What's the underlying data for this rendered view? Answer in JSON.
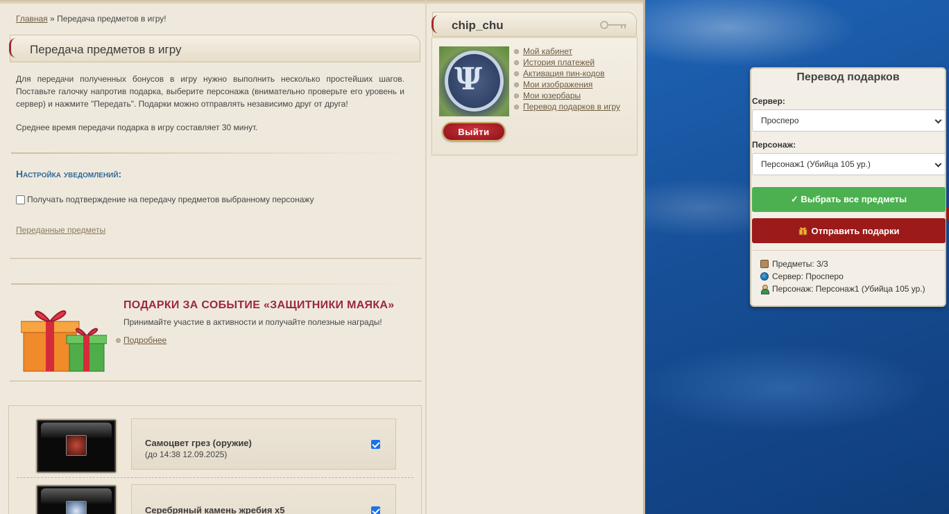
{
  "breadcrumb": {
    "home": "Главная",
    "separator": "»",
    "current": "Передача предметов в игру!"
  },
  "main": {
    "title": "Передача предметов в игру",
    "intro": "Для передачи полученных бонусов в игру нужно выполнить несколько простейших шагов. Поставьте галочку напротив подарка, выберите персонажа (внимательно проверьте его уровень и сервер) и нажмите \"Передать\". Подарки можно отправлять независимо друг от друга!",
    "avg_time": "Среднее время передачи подарка в игру составляет 30 минут.",
    "notifications": {
      "title": "Настройка уведомлений:",
      "checkbox_label": "Получать подтверждение на передачу предметов выбранному персонажу",
      "checked": false
    },
    "transferred_link": "Переданные предметы"
  },
  "event": {
    "title": "ПОДАРКИ ЗА СОБЫТИЕ «ЗАЩИТНИКИ МАЯКА»",
    "description": "Принимайте участие в активности и получайте полезные награды!",
    "more_link": "Подробнее"
  },
  "items": [
    {
      "name": "Самоцвет грез (оружие)",
      "until": "(до 14:38 12.09.2025)",
      "checked": true
    },
    {
      "name": "Серебряный камень жребия x5",
      "until": "",
      "checked": true
    }
  ],
  "user": {
    "name": "chip_chu",
    "links": [
      "Мой кабинет",
      "История платежей",
      "Активация пин-кодов",
      "Мои изображения",
      "Мои юзербары",
      "Перевод подарков в игру"
    ],
    "logout": "Выйти"
  },
  "gift_panel": {
    "title": "Перевод подарков",
    "server_label": "Сервер:",
    "server_value": "Просперо",
    "character_label": "Персонаж:",
    "character_value": "Персонаж1 (Убийца 105 ур.)",
    "select_all_button": "✓ Выбрать все предметы",
    "send_button": "Отправить подарки",
    "summary": {
      "items": "Предметы: 3/3",
      "server": "Сервер: Просперо",
      "character": "Персонаж: Персонаж1 (Убийца 105 ур.)"
    },
    "colors": {
      "green": "#4cb050",
      "red": "#9c1a1a"
    }
  }
}
